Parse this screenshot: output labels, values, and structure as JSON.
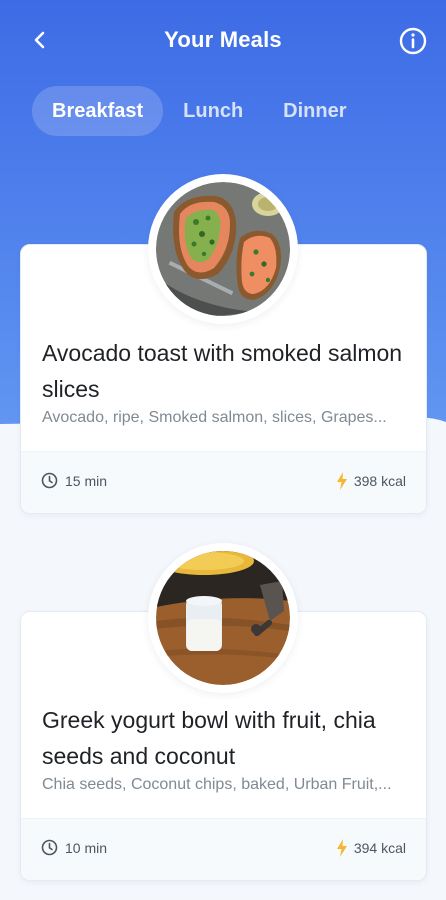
{
  "header": {
    "title": "Your Meals",
    "back_icon": "chevron-left-icon",
    "info_icon": "info-icon"
  },
  "tabs": [
    {
      "label": "Breakfast",
      "active": true
    },
    {
      "label": "Lunch",
      "active": false
    },
    {
      "label": "Dinner",
      "active": false
    }
  ],
  "meals": [
    {
      "title": "Avocado toast with smoked salmon slices",
      "ingredients": "Avocado, ripe, Smoked salmon, slices, Grapes...",
      "time": "15 min",
      "kcal": "398 kcal",
      "image": "avocado-toast-photo"
    },
    {
      "title": "Greek yogurt bowl with fruit, chia seeds and coconut",
      "ingredients": "Chia seeds, Coconut chips, baked, Urban Fruit,...",
      "time": "10 min",
      "kcal": "394 kcal",
      "image": "greek-yogurt-photo"
    }
  ],
  "colors": {
    "header_blue": "#3f6ee8",
    "header_blue_light": "#5b8ff1",
    "background": "#f4f7fb",
    "kcal_icon": "#f5b731"
  }
}
